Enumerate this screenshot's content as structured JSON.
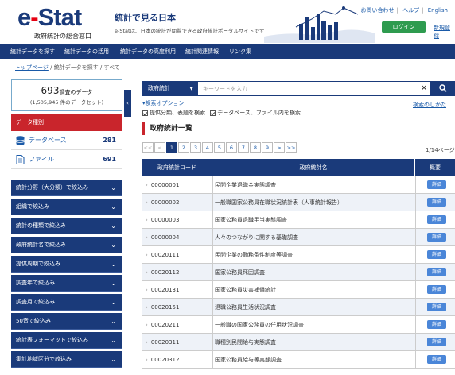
{
  "header": {
    "logo_e": "e",
    "logo_dash": "-",
    "logo_stat": "Stat",
    "logo_sub": "政府統計の総合窓口",
    "site_title": "統計で見る日本",
    "site_desc": "e-Statは、日本の統計が閲覧できる政府統計ポータルサイトです",
    "links": [
      "お問い合わせ",
      "ヘルプ",
      "English"
    ],
    "login": "ログイン",
    "register": "新規登録"
  },
  "nav": [
    "統計データを探す",
    "統計データの活用",
    "統計データの高度利用",
    "統計関連情報",
    "リンク集"
  ],
  "breadcrumb": {
    "top": "トップページ",
    "mid": "統計データを探す",
    "cur": "すべて"
  },
  "summary": {
    "count": "693",
    "count_unit": "調査のデータ",
    "datasets": "(1,505,945 件のデータセット)"
  },
  "data_type": {
    "header": "データ種別",
    "items": [
      {
        "label": "データベース",
        "count": "281"
      },
      {
        "label": "ファイル",
        "count": "691"
      }
    ]
  },
  "facets": [
    "統計分野（大分類）で絞込み",
    "組織で絞込み",
    "統計の種類で絞込み",
    "政府統計名で絞込み",
    "提供周期で絞込み",
    "調査年で絞込み",
    "調査月で絞込み",
    "50音で絞込み",
    "統計表フォーマットで絞込み",
    "集計地域区分で絞込み"
  ],
  "search": {
    "scope": "政府統計",
    "placeholder": "キーワードを入力",
    "options_link": "検索オプション",
    "howto": "検索のしかた",
    "check1": "提供分類、表題を検索",
    "check2": "データベース、ファイル内を検索"
  },
  "section_title": "政府統計一覧",
  "pager": {
    "first": "<<",
    "prev": "<",
    "pages": [
      "1",
      "2",
      "3",
      "4",
      "5",
      "6",
      "7",
      "8",
      "9"
    ],
    "next": ">",
    "last": ">>",
    "info": "1/14ページ"
  },
  "table": {
    "headers": [
      "政府統計コード",
      "政府統計名",
      "概要"
    ],
    "detail_label": "詳細",
    "rows": [
      {
        "code": "00000001",
        "name": "民間企業退職金実態調査"
      },
      {
        "code": "00000002",
        "name": "一般職国家公務員在職状況統計表（人事統計報告）"
      },
      {
        "code": "00000003",
        "name": "国家公務員退職手当実態調査"
      },
      {
        "code": "00000004",
        "name": "人々のつながりに関する基礎調査"
      },
      {
        "code": "00020111",
        "name": "民間企業の勤務条件制度等調査"
      },
      {
        "code": "00020112",
        "name": "国家公務員死因調査"
      },
      {
        "code": "00020131",
        "name": "国家公務員災害補償統計"
      },
      {
        "code": "00020151",
        "name": "退職公務員生活状況調査"
      },
      {
        "code": "00020211",
        "name": "一般職の国家公務員の任用状況調査"
      },
      {
        "code": "00020311",
        "name": "職種別民間給与実態調査"
      },
      {
        "code": "00020312",
        "name": "国家公務員給与等実態調査"
      }
    ]
  }
}
